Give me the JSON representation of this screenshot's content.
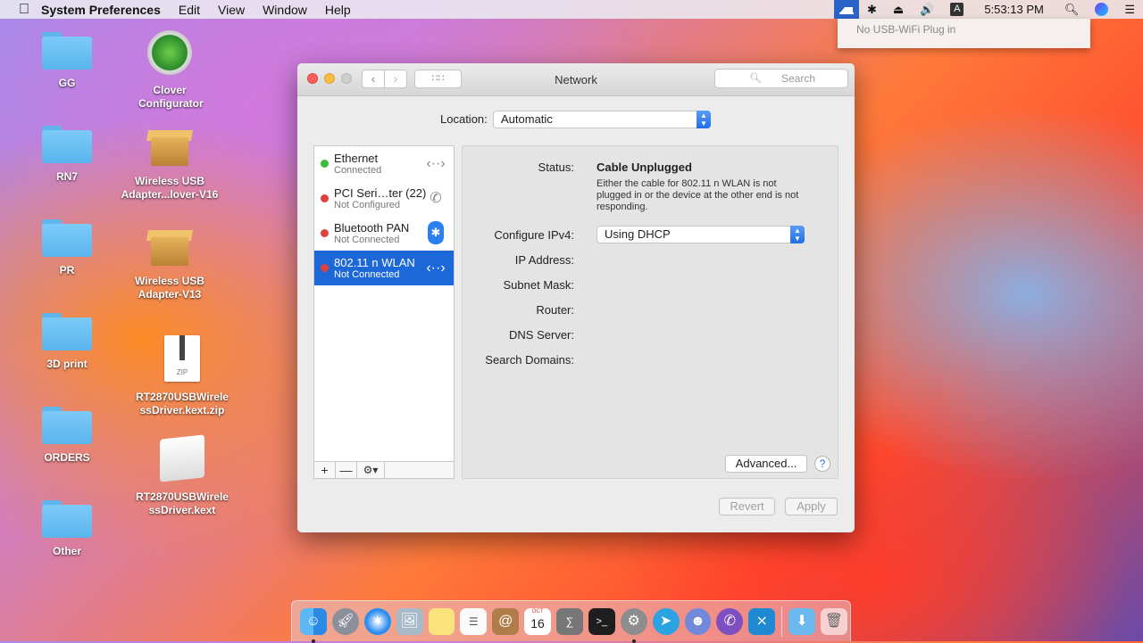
{
  "menubar": {
    "app": "System Preferences",
    "items": [
      "Edit",
      "View",
      "Window",
      "Help"
    ],
    "clock": "5:53:13 PM",
    "input_source": "A",
    "status_icons": [
      "usb-wifi-icon",
      "bluetooth-icon",
      "eject-icon",
      "volume-icon",
      "input-source-icon",
      "spotlight-icon",
      "siri-icon",
      "notification-center-icon"
    ]
  },
  "usb_menu": {
    "item": "No USB-WiFi Plug in"
  },
  "desktop": {
    "folders": [
      "GG",
      "RN7",
      "PR",
      "3D print",
      "ORDERS",
      "Other"
    ],
    "clover": "Clover Configurator",
    "pkg1": "Wireless USB Adapter...lover-V16",
    "pkg2": "Wireless USB Adapter-V13",
    "zip": "RT2870USBWirelessDriver.kext.zip",
    "zip_badge": "ZIP",
    "kext": "RT2870USBWirelessDriver.kext"
  },
  "window": {
    "title": "Network",
    "search_placeholder": "Search",
    "location_label": "Location:",
    "location_value": "Automatic",
    "services": [
      {
        "name": "Ethernet",
        "status": "Connected",
        "dot": "#3cba3c",
        "icon": "ethernet-icon"
      },
      {
        "name": "PCI Seri…ter (22)",
        "status": "Not Configured",
        "dot": "#e0403a",
        "icon": "phone-modem-icon"
      },
      {
        "name": "Bluetooth PAN",
        "status": "Not Connected",
        "dot": "#e0403a",
        "icon": "bluetooth-icon"
      },
      {
        "name": "802.11 n WLAN",
        "status": "Not Connected",
        "dot": "#e0403a",
        "icon": "ethernet-icon"
      }
    ],
    "list_buttons": {
      "add": "+",
      "remove": "—",
      "gear": "⚙▾"
    },
    "detail": {
      "status_label": "Status:",
      "status_value": "Cable Unplugged",
      "status_desc": "Either the cable for 802.11 n WLAN is not plugged in or the device at the other end is not responding.",
      "configure_label": "Configure IPv4:",
      "configure_value": "Using DHCP",
      "ip_label": "IP Address:",
      "subnet_label": "Subnet Mask:",
      "router_label": "Router:",
      "dns_label": "DNS Server:",
      "search_domains_label": "Search Domains:",
      "advanced": "Advanced...",
      "help": "?"
    },
    "revert": "Revert",
    "apply": "Apply"
  },
  "dock": {
    "apps": [
      "finder-icon",
      "launchpad-icon",
      "safari-icon",
      "preview-icon",
      "notes-icon",
      "reminders-icon",
      "contacts-icon",
      "calendar-icon",
      "calculator-icon",
      "terminal-icon",
      "system-preferences-icon",
      "telegram-icon",
      "discord-icon",
      "viber-icon",
      "vscode-icon",
      "downloads-icon",
      "trash-icon"
    ],
    "calendar_day": "16",
    "calendar_month": "OCT"
  }
}
